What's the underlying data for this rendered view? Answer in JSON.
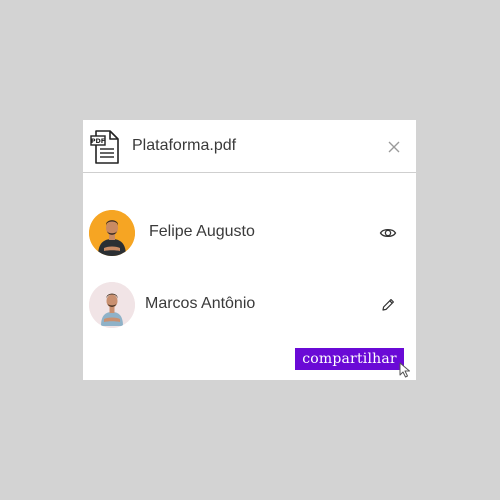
{
  "dialog": {
    "file_icon": "pdf-file-icon",
    "file_name": "Plataforma.pdf",
    "close_icon": "close-icon"
  },
  "users": [
    {
      "name": "Felipe Augusto",
      "permission_icon": "eye-icon",
      "avatar_bg": "#f5a623"
    },
    {
      "name": "Marcos Antônio",
      "permission_icon": "pencil-icon",
      "avatar_bg": "#f1e4e6"
    }
  ],
  "share_button": {
    "label": "compartilhar"
  },
  "colors": {
    "accent": "#6a0ad6",
    "background": "#d3d3d3",
    "card": "#ffffff"
  }
}
